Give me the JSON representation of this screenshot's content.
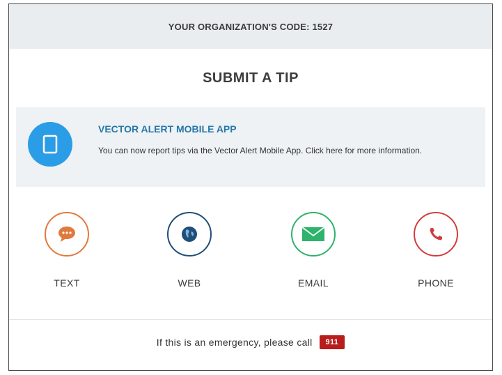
{
  "header": {
    "org_code_text": "YOUR ORGANIZATION'S CODE: 1527"
  },
  "title": "SUBMIT A TIP",
  "app_promo": {
    "title": "VECTOR ALERT MOBILE APP",
    "description": "You can now report tips via the Vector Alert Mobile App. Click here for more information.",
    "icon": "tablet-icon",
    "color": "#2b9de6"
  },
  "channels": [
    {
      "label": "TEXT",
      "icon": "chat-bubble-icon",
      "color": "#e07a3c"
    },
    {
      "label": "WEB",
      "icon": "globe-icon",
      "color": "#1f4e79"
    },
    {
      "label": "EMAIL",
      "icon": "envelope-icon",
      "color": "#2db36b"
    },
    {
      "label": "PHONE",
      "icon": "phone-icon",
      "color": "#d23c3c"
    }
  ],
  "emergency": {
    "text": "If this is an emergency, please call",
    "number": "911",
    "badge_color": "#b81c1c"
  }
}
